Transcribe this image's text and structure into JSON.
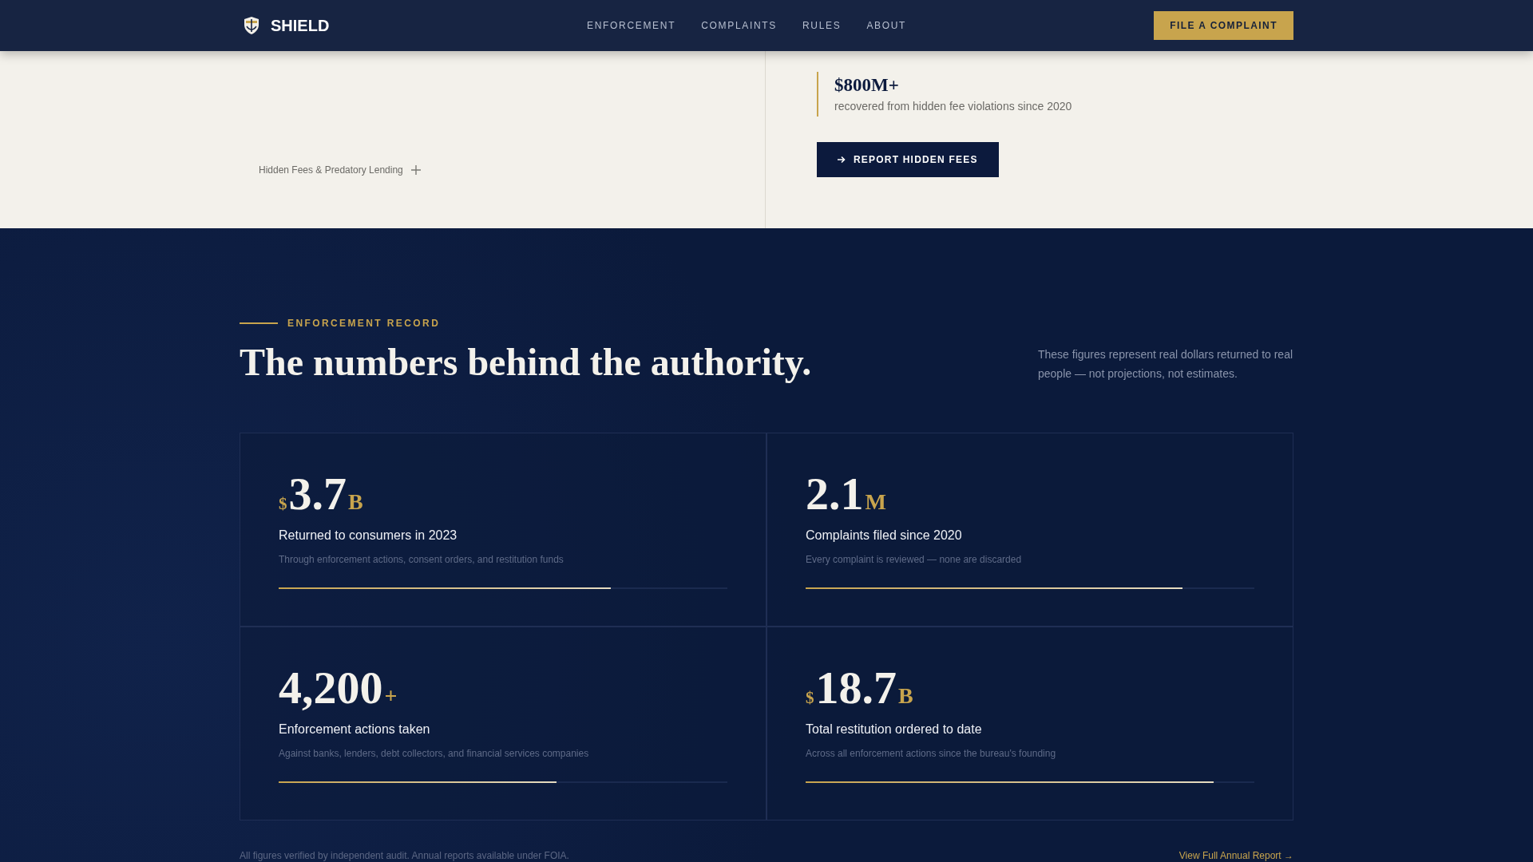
{
  "header": {
    "brand": "SHIELD",
    "nav": [
      {
        "label": "ENFORCEMENT"
      },
      {
        "label": "COMPLAINTS"
      },
      {
        "label": "RULES"
      },
      {
        "label": "ABOUT"
      }
    ],
    "cta": "FILE A COMPLAINT"
  },
  "hero": {
    "topic": "Hidden Fees & Predatory Lending",
    "stat": {
      "value": "$800M+",
      "caption": "recovered from hidden fee violations since 2020"
    },
    "button": "REPORT HIDDEN FEES"
  },
  "record": {
    "eyebrow": "ENFORCEMENT RECORD",
    "heading": "The numbers behind the authority.",
    "intro": "These figures represent real dollars returned to real people — not projections, not estimates.",
    "stats": [
      {
        "prefix": "$",
        "value": "3.7",
        "suffix": "B",
        "label": "Returned to consumers in 2023",
        "description": "Through enforcement actions, consent orders, and restitution funds",
        "level": 0.74
      },
      {
        "value": "2.1",
        "suffix": "M",
        "label": "Complaints filed since 2020",
        "description": "Every complaint is reviewed — none are discarded",
        "level": 0.84
      },
      {
        "value": "4,200",
        "suffix": "+",
        "label": "Enforcement actions taken",
        "description": "Against banks, lenders, debt collectors, and financial services companies",
        "level": 0.62
      },
      {
        "prefix": "$",
        "value": "18.7",
        "suffix": "B",
        "label": "Total restitution ordered to date",
        "description": "Across all enforcement actions since the bureau's founding",
        "level": 0.91
      }
    ],
    "footnote": "All figures verified by independent audit. Annual reports available under FOIA.",
    "link": "View Full Annual Report →"
  }
}
